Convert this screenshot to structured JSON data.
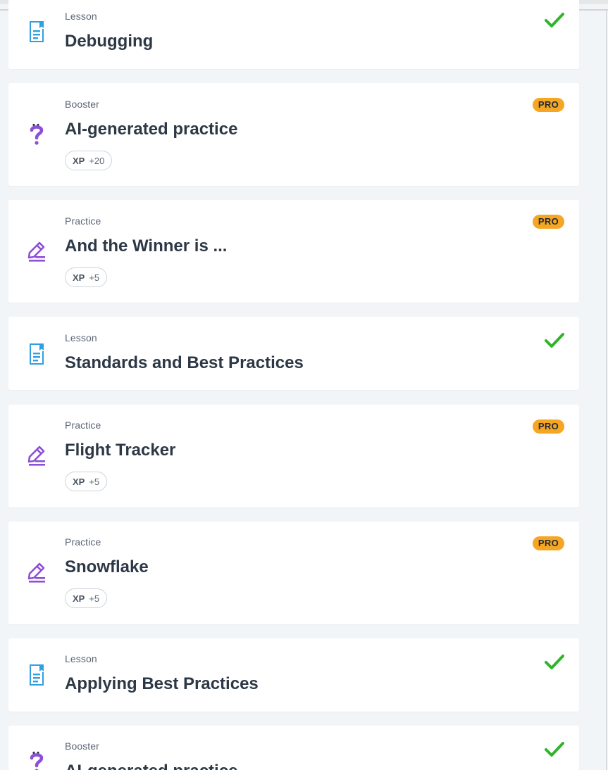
{
  "colors": {
    "page_bg": "#f2f5f7",
    "card_bg": "#ffffff",
    "lesson_icon": "#2f9fe2",
    "practice_icon": "#8b4fd8",
    "booster_icon": "#8b4fd8",
    "check": "#2fb52a",
    "pro_badge": "#f5a623",
    "title_text": "#2d3846"
  },
  "items": [
    {
      "kind": "Lesson",
      "title": "Debugging",
      "icon": "lesson-document-icon",
      "completed": true
    },
    {
      "kind": "Booster",
      "title": "AI-generated practice",
      "icon": "booster-question-icon",
      "badge": "PRO",
      "xp_label": "XP",
      "xp_value": "+20"
    },
    {
      "kind": "Practice",
      "title": "And the Winner is ...",
      "icon": "practice-pencil-icon",
      "badge": "PRO",
      "xp_label": "XP",
      "xp_value": "+5"
    },
    {
      "kind": "Lesson",
      "title": "Standards and Best Practices",
      "icon": "lesson-document-icon",
      "completed": true
    },
    {
      "kind": "Practice",
      "title": "Flight Tracker",
      "icon": "practice-pencil-icon",
      "badge": "PRO",
      "xp_label": "XP",
      "xp_value": "+5"
    },
    {
      "kind": "Practice",
      "title": "Snowflake",
      "icon": "practice-pencil-icon",
      "badge": "PRO",
      "xp_label": "XP",
      "xp_value": "+5"
    },
    {
      "kind": "Lesson",
      "title": "Applying Best Practices",
      "icon": "lesson-document-icon",
      "completed": true
    },
    {
      "kind": "Booster",
      "title": "AI-generated practice",
      "icon": "booster-question-icon",
      "completed": true
    }
  ]
}
